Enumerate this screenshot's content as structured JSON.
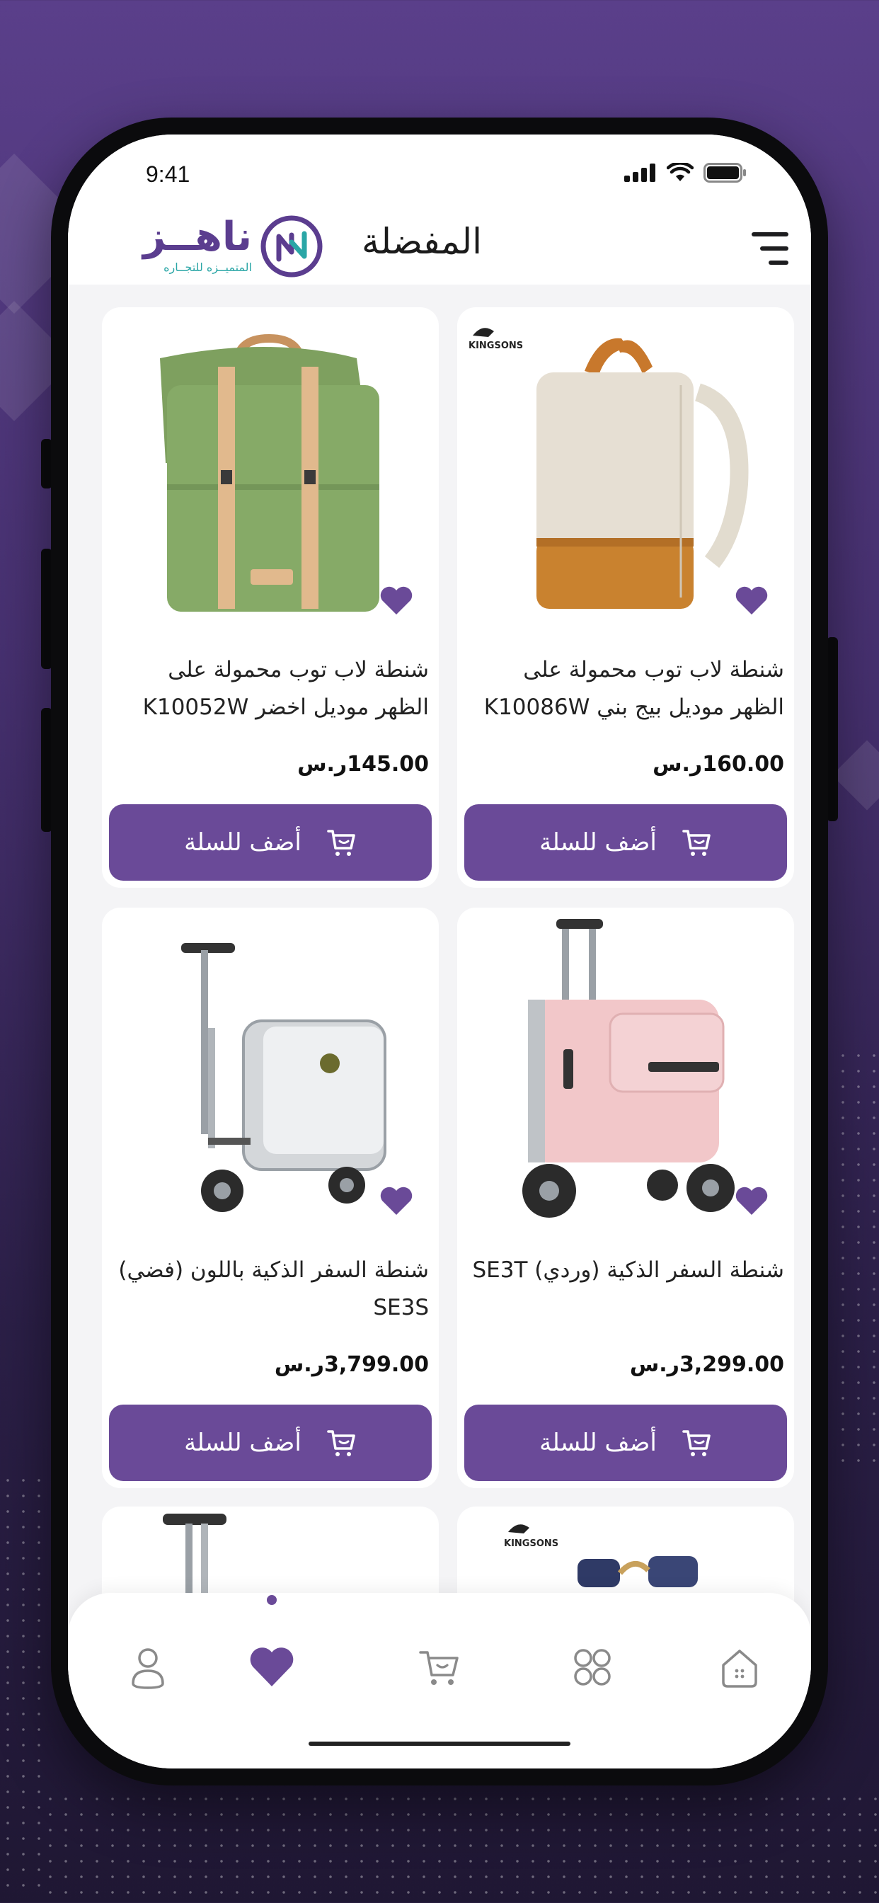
{
  "status_bar": {
    "time": "9:41"
  },
  "header": {
    "title": "المفضلة",
    "logo_text": "ناهــز",
    "logo_tagline": "المتميــزه للتجــاره"
  },
  "products": [
    {
      "name": "شنطة لاب توب محمولة على الظهر موديل بيج بني K10086W",
      "price": "160.00ر.س",
      "add_label": "أضف للسلة",
      "brand": "KINGSONS"
    },
    {
      "name": "شنطة لاب توب محمولة على الظهر موديل اخضر K10052W",
      "price": "145.00ر.س",
      "add_label": "أضف للسلة"
    },
    {
      "name": "شنطة السفر الذكية (وردي) SE3T",
      "price": "3,299.00ر.س",
      "add_label": "أضف للسلة"
    },
    {
      "name": "شنطة السفر الذكية باللون (فضي) SE3S",
      "price": "3,799.00ر.س",
      "add_label": "أضف للسلة"
    },
    {
      "brand": "KINGSONS"
    }
  ],
  "bottom_nav": {
    "items": [
      "home-icon",
      "categories-icon",
      "cart-icon",
      "heart-icon",
      "profile-icon"
    ],
    "active": "favorites"
  },
  "colors": {
    "accent": "#6a4a98",
    "logo_teal": "#2aa6a6"
  }
}
